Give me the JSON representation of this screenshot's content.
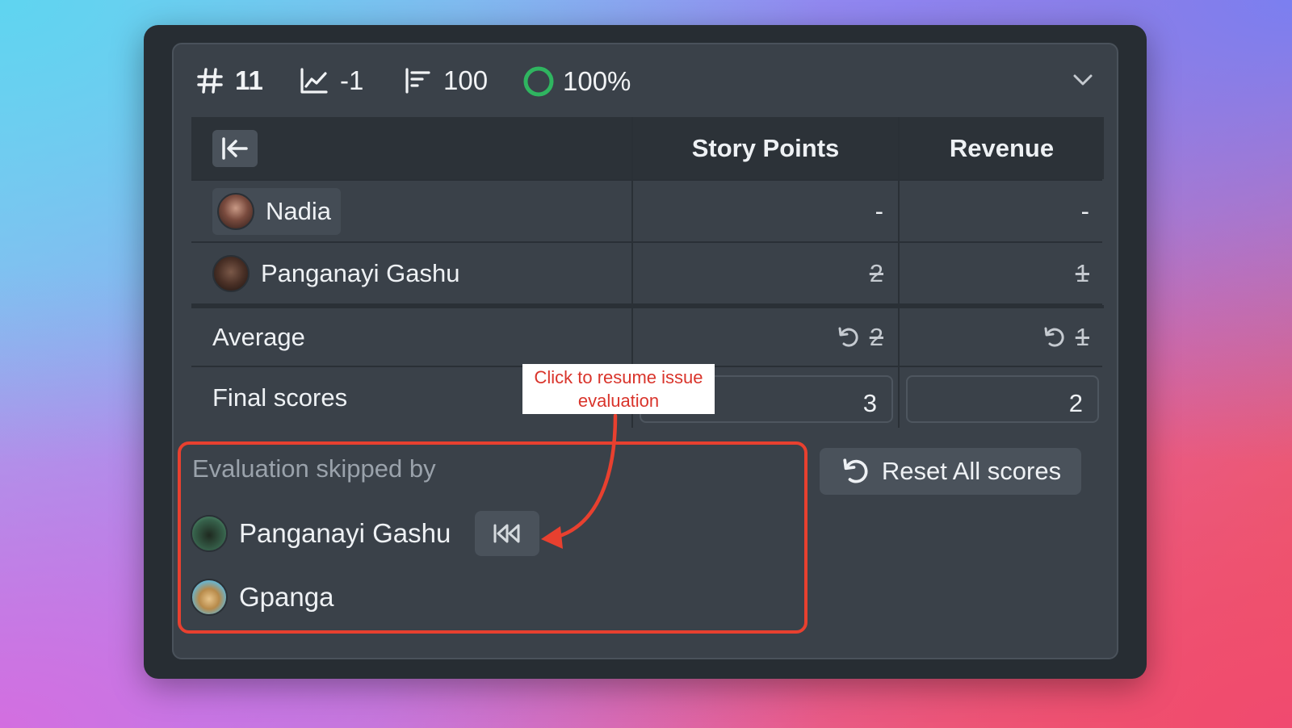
{
  "stats": {
    "issue_number": "11",
    "trend": "-1",
    "priority": "100",
    "progress": "100%",
    "progress_fraction": 1.0
  },
  "table": {
    "columns": [
      "Story Points",
      "Revenue"
    ],
    "rows": [
      {
        "name": "Nadia",
        "story_points": "-",
        "revenue": "-"
      },
      {
        "name": "Panganayi Gashu",
        "story_points": "2",
        "revenue": "1"
      }
    ],
    "average": {
      "label": "Average",
      "story_points": "2",
      "revenue": "1"
    },
    "final": {
      "label": "Final scores",
      "story_points": "3",
      "revenue": "2"
    }
  },
  "skipped": {
    "title": "Evaluation skipped by",
    "users": [
      {
        "name": "Panganayi Gashu"
      },
      {
        "name": "Gpanga"
      }
    ]
  },
  "reset_label": "Reset All scores",
  "callout": "Click to resume issue evaluation",
  "colors": {
    "accent_green": "#2fb560",
    "annotation_red": "#e8402f",
    "panel": "#3a4149",
    "frame": "#272d33"
  },
  "icons": [
    "hash-icon",
    "trend-chart-icon",
    "priority-bars-icon",
    "progress-ring-icon",
    "chevron-down-icon",
    "collapse-left-icon",
    "undo-icon",
    "resume-icon"
  ]
}
